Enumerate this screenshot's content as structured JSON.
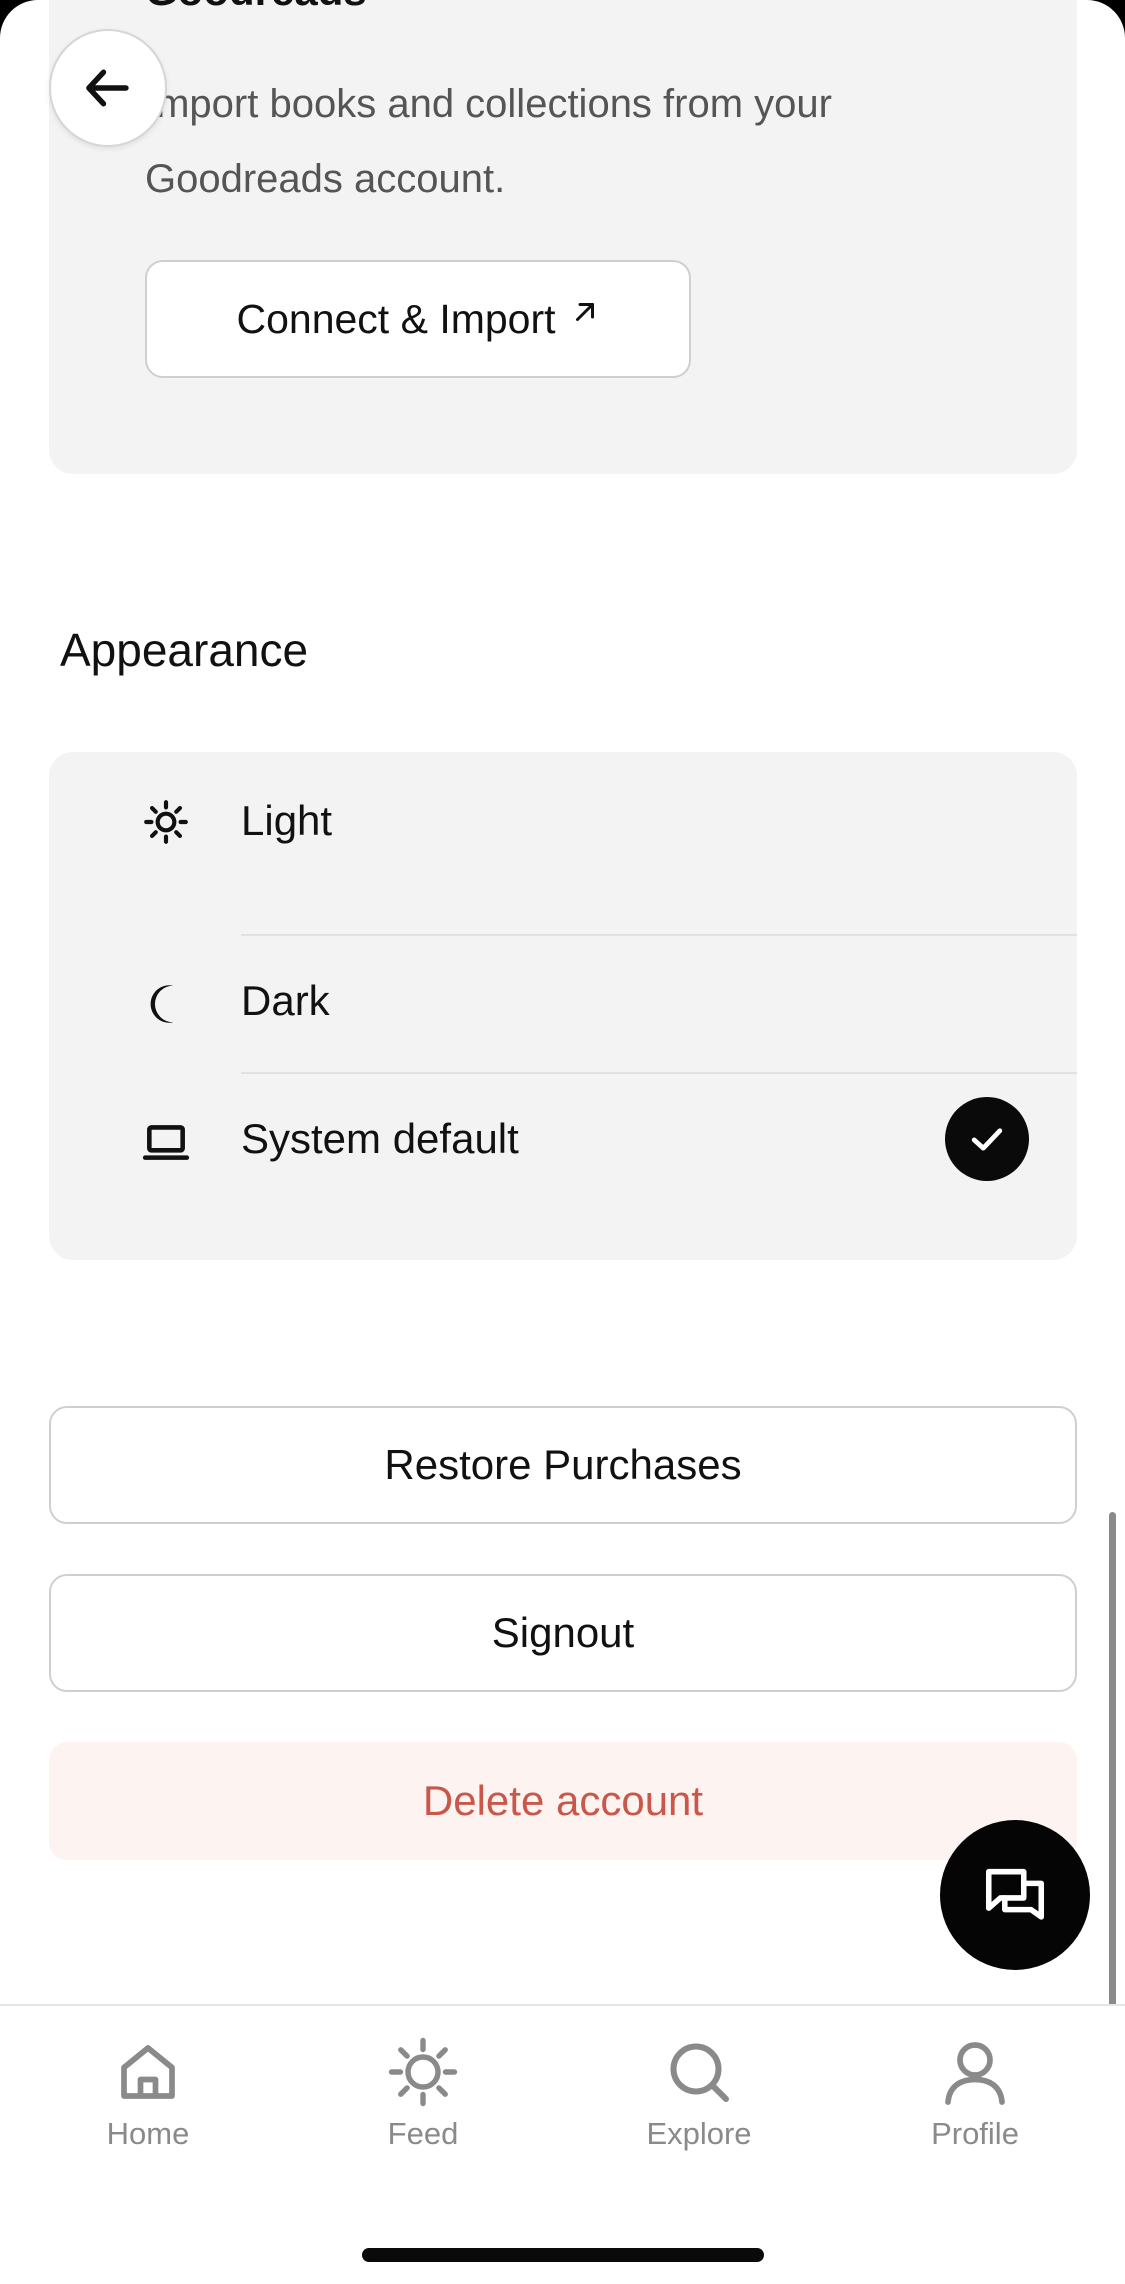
{
  "goodreads": {
    "title": "Goodreads",
    "description": "Import books and collections from your Goodreads account.",
    "connect_label": "Connect & Import",
    "connect_icon": "external-arrow-icon"
  },
  "back": {
    "icon": "arrow-left-icon"
  },
  "appearance": {
    "heading": "Appearance",
    "options": [
      {
        "label": "Light",
        "icon": "sun-icon",
        "selected": false
      },
      {
        "label": "Dark",
        "icon": "moon-icon",
        "selected": false
      },
      {
        "label": "System default",
        "icon": "laptop-icon",
        "selected": true
      }
    ]
  },
  "account": {
    "restore_label": "Restore Purchases",
    "signout_label": "Signout",
    "delete_label": "Delete account"
  },
  "chat": {
    "icon": "chat-bubbles-icon"
  },
  "tabs": [
    {
      "label": "Home",
      "icon": "home-icon"
    },
    {
      "label": "Feed",
      "icon": "sun-icon"
    },
    {
      "label": "Explore",
      "icon": "search-icon"
    },
    {
      "label": "Profile",
      "icon": "person-icon"
    }
  ],
  "colors": {
    "card_bg": "#f3f3f3",
    "danger": "#c9574a",
    "danger_bg": "#fdf3f1",
    "primary": "#0a0a0a",
    "tab_inactive": "#8a8a8a"
  }
}
